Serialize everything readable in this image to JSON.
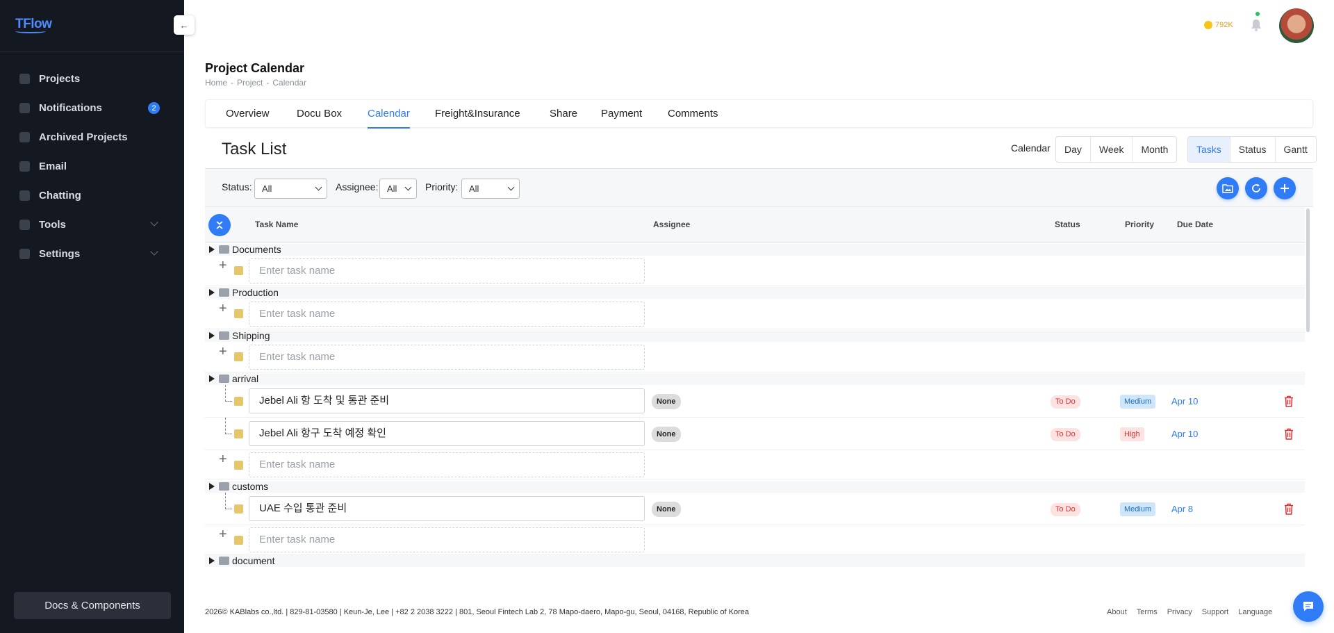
{
  "app": {
    "logo": "TFlow"
  },
  "sidebar": {
    "items": [
      {
        "label": "Projects",
        "icon": "grid-icon"
      },
      {
        "label": "Notifications",
        "icon": "bell-icon",
        "badge": "2"
      },
      {
        "label": "Archived Projects",
        "icon": "archive-icon"
      },
      {
        "label": "Email",
        "icon": "mail-icon"
      },
      {
        "label": "Chatting",
        "icon": "chat-icon"
      },
      {
        "label": "Tools",
        "icon": "wrench-icon",
        "expandable": true
      },
      {
        "label": "Settings",
        "icon": "gear-icon",
        "expandable": true
      }
    ],
    "docs_button": "Docs & Components"
  },
  "topbar": {
    "credits": "792K"
  },
  "page": {
    "title": "Project Calendar",
    "breadcrumb": [
      "Home",
      "Project",
      "Calendar"
    ]
  },
  "tabs": [
    "Overview",
    "Docu Box",
    "Calendar",
    "Freight&Insurance",
    "Share",
    "Payment",
    "Comments"
  ],
  "active_tab": "Calendar",
  "panel": {
    "title": "Task List",
    "calendar_label": "Calendar",
    "range_buttons": [
      "Day",
      "Week",
      "Month"
    ],
    "view_buttons": [
      "Tasks",
      "Status",
      "Gantt"
    ],
    "active_view": "Tasks"
  },
  "filters": {
    "status_label": "Status:",
    "status_value": "All",
    "assignee_label": "Assignee:",
    "assignee_value": "All",
    "priority_label": "Priority:",
    "priority_value": "All"
  },
  "table": {
    "headers": [
      "Task Name",
      "Assignee",
      "Status",
      "Priority",
      "Due Date"
    ],
    "placeholder": "Enter task name",
    "groups": [
      {
        "name": "Documents",
        "tasks": []
      },
      {
        "name": "Production",
        "tasks": []
      },
      {
        "name": "Shipping",
        "tasks": []
      },
      {
        "name": "arrival",
        "tasks": [
          {
            "name": "Jebel Ali 항 도착 및 통관 준비",
            "assignee": "None",
            "status": "To Do",
            "priority": "Medium",
            "due": "Apr 10"
          },
          {
            "name": "Jebel Ali 항구 도착 예정 확인",
            "assignee": "None",
            "status": "To Do",
            "priority": "High",
            "due": "Apr 10"
          }
        ]
      },
      {
        "name": "customs",
        "tasks": [
          {
            "name": "UAE 수입 통관 준비",
            "assignee": "None",
            "status": "To Do",
            "priority": "Medium",
            "due": "Apr 8"
          }
        ]
      },
      {
        "name": "document",
        "tasks": []
      }
    ]
  },
  "footer": {
    "text": "2026© KABlabs co.,ltd. | 829-81-03580 | Keun-Je, Lee | +82 2 2038 3222 | 801, Seoul Fintech Lab 2, 78 Mapo-daero, Mapo-gu, Seoul, 04168, Republic of Korea",
    "links": [
      "About",
      "Terms",
      "Privacy",
      "Support",
      "Language"
    ]
  },
  "colors": {
    "accent": "#2f7cf6",
    "sidebar_bg": "#141820",
    "danger": "#e03131"
  }
}
